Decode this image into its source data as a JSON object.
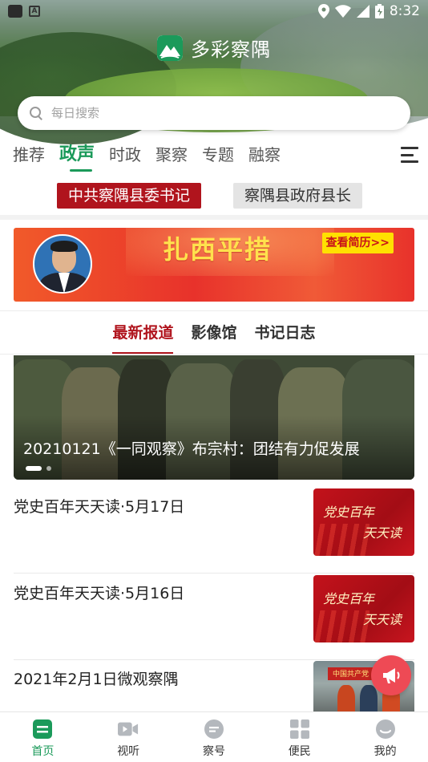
{
  "status_bar": {
    "time": "8:32"
  },
  "app": {
    "title": "多彩察隅"
  },
  "search": {
    "placeholder": "每日搜索"
  },
  "channel_tabs": [
    {
      "label": "推荐"
    },
    {
      "label": "政声",
      "active": true
    },
    {
      "label": "时政"
    },
    {
      "label": "聚察"
    },
    {
      "label": "专题"
    },
    {
      "label": "融察"
    }
  ],
  "leaders": {
    "party_secretary": "中共察隅县委书记",
    "county_head": "察隅县政府县长"
  },
  "banner": {
    "name": "扎西平措",
    "resume_button": "查看简历>>"
  },
  "section_tabs": [
    {
      "label": "最新报道",
      "active": true
    },
    {
      "label": "影像馆"
    },
    {
      "label": "书记日志"
    }
  ],
  "hero": {
    "caption": "20210121《一同观察》布宗村：团结有力促发展"
  },
  "news": [
    {
      "title": "党史百年天天读·5月17日",
      "thumb_text_1": "党史百年",
      "thumb_text_2": "天天读"
    },
    {
      "title": "党史百年天天读·5月16日",
      "thumb_text_1": "党史百年",
      "thumb_text_2": "天天读"
    },
    {
      "title": "2021年2月1日微观察隅"
    }
  ],
  "bottom_nav": [
    {
      "label": "首页",
      "icon": "home-icon",
      "active": true
    },
    {
      "label": "视听",
      "icon": "video-icon"
    },
    {
      "label": "察号",
      "icon": "chat-icon"
    },
    {
      "label": "便民",
      "icon": "grid-icon"
    },
    {
      "label": "我的",
      "icon": "profile-icon"
    }
  ],
  "colors": {
    "accent_green": "#1b9a5a",
    "party_red": "#b0141d",
    "fab_red": "#ee4a55"
  }
}
